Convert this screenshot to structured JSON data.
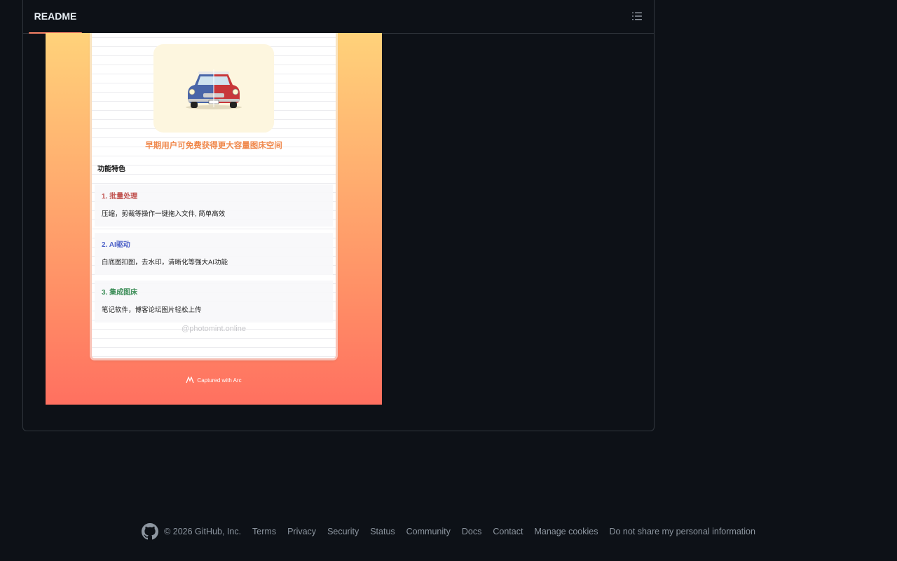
{
  "readme": {
    "tab_label": "README",
    "outline_icon": "list-unordered-icon"
  },
  "screenshot": {
    "promo_text": "早期用户可免费获得更大容量图床空间",
    "features_title": "功能特色",
    "features": [
      {
        "title": "1. 批量处理",
        "desc": "压缩，剪裁等操作一键拖入文件, 简单高效",
        "color": "#c0504d"
      },
      {
        "title": "2. AI驱动",
        "desc": "白底图扣图，去水印，清晰化等强大AI功能",
        "color": "#4f63c9"
      },
      {
        "title": "3. 集成图床",
        "desc": "笔记软件，博客论坛图片轻松上传",
        "color": "#3f8f5a"
      }
    ],
    "watermark": "@photomint.online",
    "captured_with": "Captured with Arc"
  },
  "footer": {
    "copyright": "© 2026 GitHub, Inc.",
    "links": [
      "Terms",
      "Privacy",
      "Security",
      "Status",
      "Community",
      "Docs",
      "Contact",
      "Manage cookies",
      "Do not share my personal information"
    ]
  },
  "colors": {
    "background": "#0d1117",
    "border": "#30363d",
    "tab_underline": "#f78166",
    "muted_text": "#8d96a0"
  }
}
